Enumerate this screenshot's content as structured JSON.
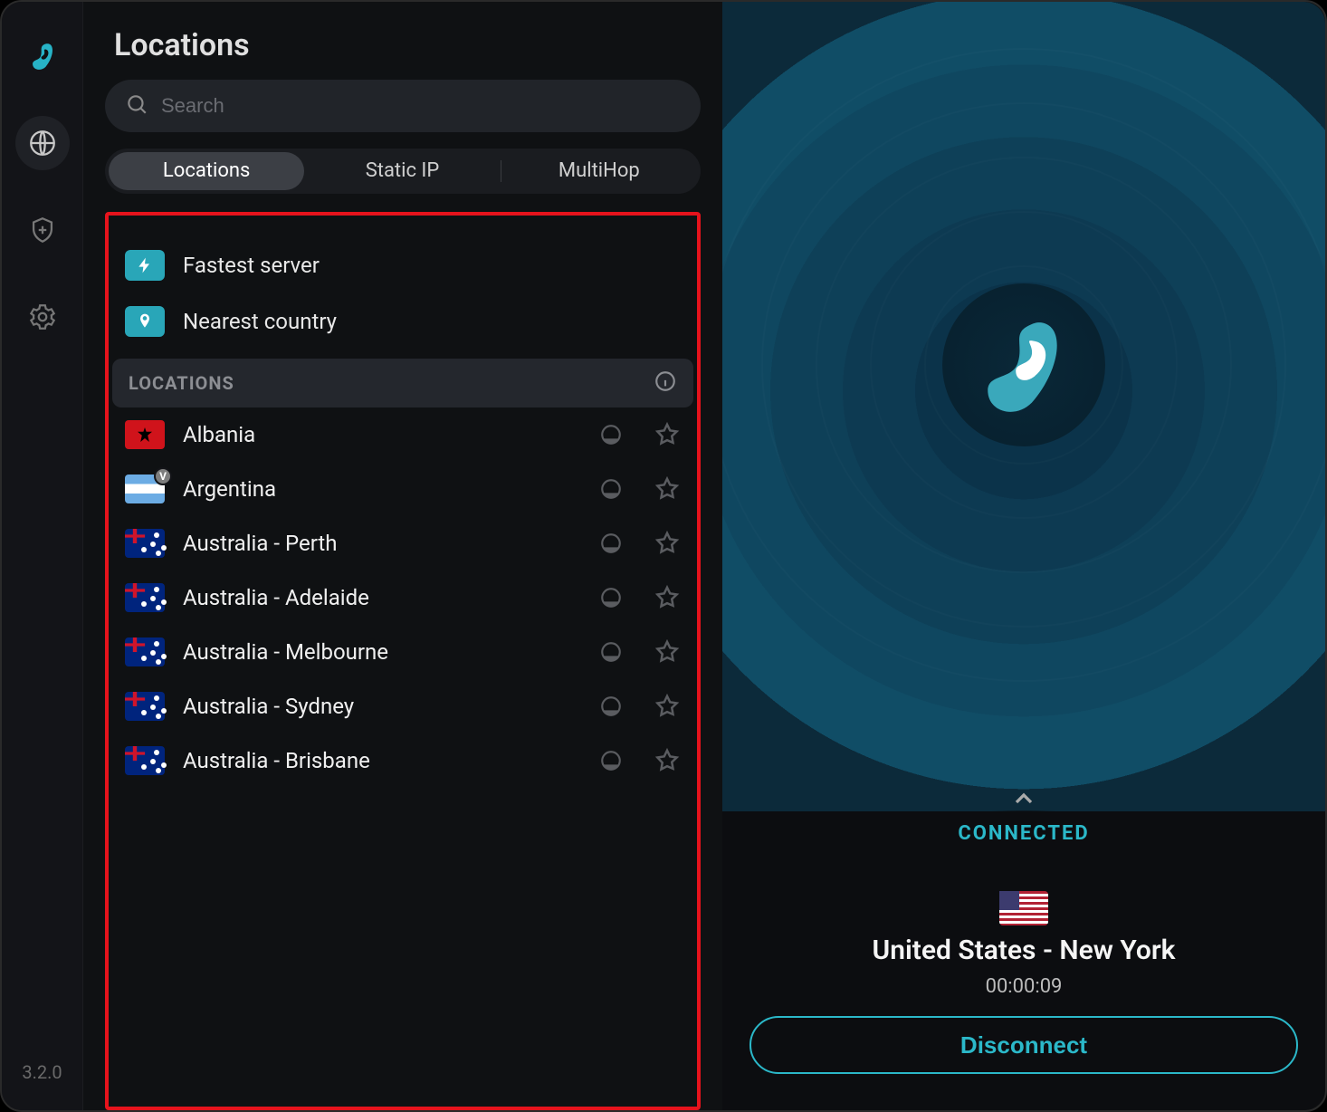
{
  "version": "3.2.0",
  "nav": {
    "items": [
      "logo",
      "locations",
      "shield",
      "settings"
    ]
  },
  "locations_panel": {
    "title": "Locations",
    "search_placeholder": "Search",
    "tabs": [
      {
        "label": "Locations",
        "active": true
      },
      {
        "label": "Static IP",
        "active": false
      },
      {
        "label": "MultiHop",
        "active": false
      }
    ],
    "quick": [
      {
        "icon": "bolt",
        "label": "Fastest server"
      },
      {
        "icon": "pin",
        "label": "Nearest country"
      }
    ],
    "section_label": "LOCATIONS",
    "countries": [
      {
        "flag": "al",
        "name": "Albania",
        "v": false
      },
      {
        "flag": "ar",
        "name": "Argentina",
        "v": true
      },
      {
        "flag": "au",
        "name": "Australia - Perth",
        "v": false
      },
      {
        "flag": "au",
        "name": "Australia - Adelaide",
        "v": false
      },
      {
        "flag": "au",
        "name": "Australia - Melbourne",
        "v": false
      },
      {
        "flag": "au",
        "name": "Australia - Sydney",
        "v": false
      },
      {
        "flag": "au",
        "name": "Australia - Brisbane",
        "v": false
      }
    ]
  },
  "status": {
    "label": "CONNECTED",
    "flag": "us",
    "location": "United States - New York",
    "timer": "00:00:09",
    "disconnect_label": "Disconnect"
  }
}
